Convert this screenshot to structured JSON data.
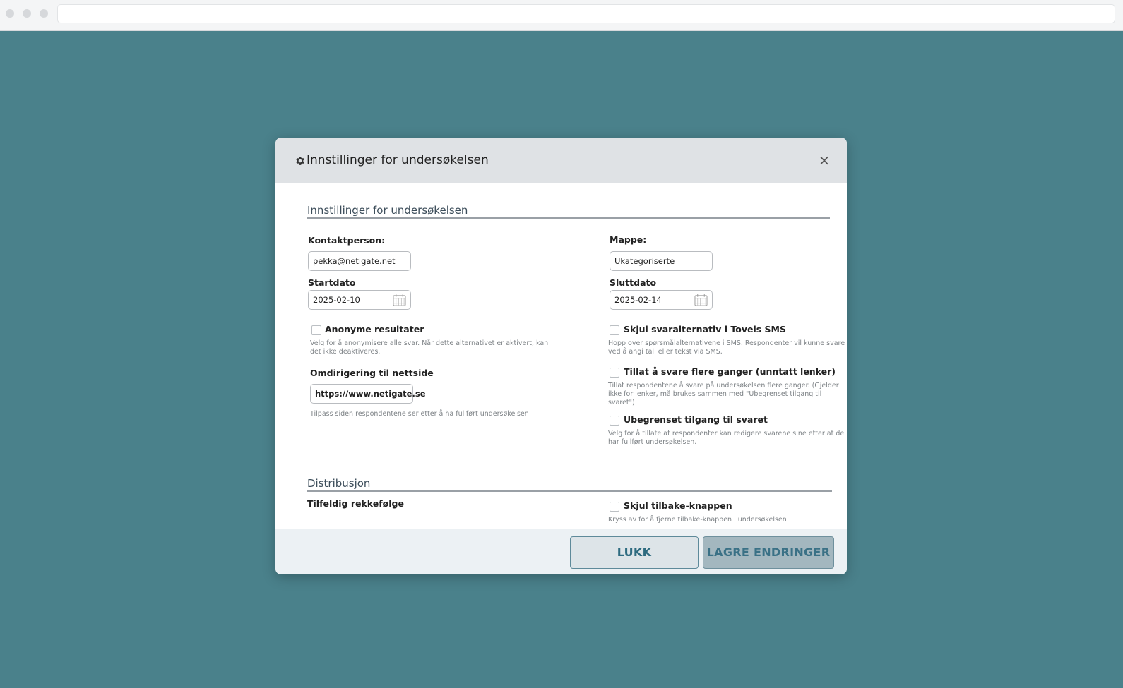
{
  "modal": {
    "title": "Innstillinger for undersøkelsen",
    "close_symbol": "×"
  },
  "settings_section": {
    "title": "Innstillinger for undersøkelsen",
    "contact_label": "Kontaktperson:",
    "contact_value": "pekka@netigate.net",
    "folder_label": "Mappe:",
    "folder_value": "Ukategoriserte",
    "start_label": "Startdato",
    "start_value": "2025-02-10",
    "end_label": "Sluttdato",
    "end_value": "2025-02-14",
    "anonymous_label": "Anonyme resultater",
    "anonymous_hint_1": "Velg for å anonymisere alle svar. Når dette alternativet er aktivert, kan",
    "anonymous_hint_2": "det ikke deaktiveres.",
    "redirect_label": "Omdirigering til nettside",
    "redirect_value": "https://www.netigate.se",
    "redirect_hint": "Tilpass siden respondentene ser etter å ha fullført undersøkelsen",
    "sms_label": "Skjul svaralternativ i Toveis SMS",
    "sms_hint_1": "Hopp over spørsmålalternativene i SMS. Respondenter vil kunne svare",
    "sms_hint_2": "ved å angi tall eller tekst via SMS.",
    "multiple_label": "Tillat å svare flere ganger (unntatt lenker)",
    "multiple_hint_1": "Tillat respondentene å svare på undersøkelsen flere ganger. (Gjelder",
    "multiple_hint_2": "ikke for lenker, må brukes sammen med \"Ubegrenset tilgang til svaret\")",
    "unlimited_label": "Ubegrenset tilgang til svaret",
    "unlimited_hint_1": "Velg for å tillate at respondenter kan redigere svarene sine etter at de",
    "unlimited_hint_2": "har fullført undersøkelsen."
  },
  "distribution_section": {
    "title": "Distribusjon",
    "random_order_label": "Tilfeldig rekkefølge",
    "hide_back_label": "Skjul tilbake-knappen",
    "hide_back_hint": "Kryss av for å fjerne tilbake-knappen i undersøkelsen"
  },
  "footer": {
    "close_label": "LUKK",
    "save_label": "LAGRE ENDRINGER"
  },
  "colors": {
    "background": "#4a818b",
    "accent": "#2e6b80"
  },
  "icons": [
    "gear-icon",
    "close-icon",
    "calendar-icon",
    "checkbox"
  ]
}
